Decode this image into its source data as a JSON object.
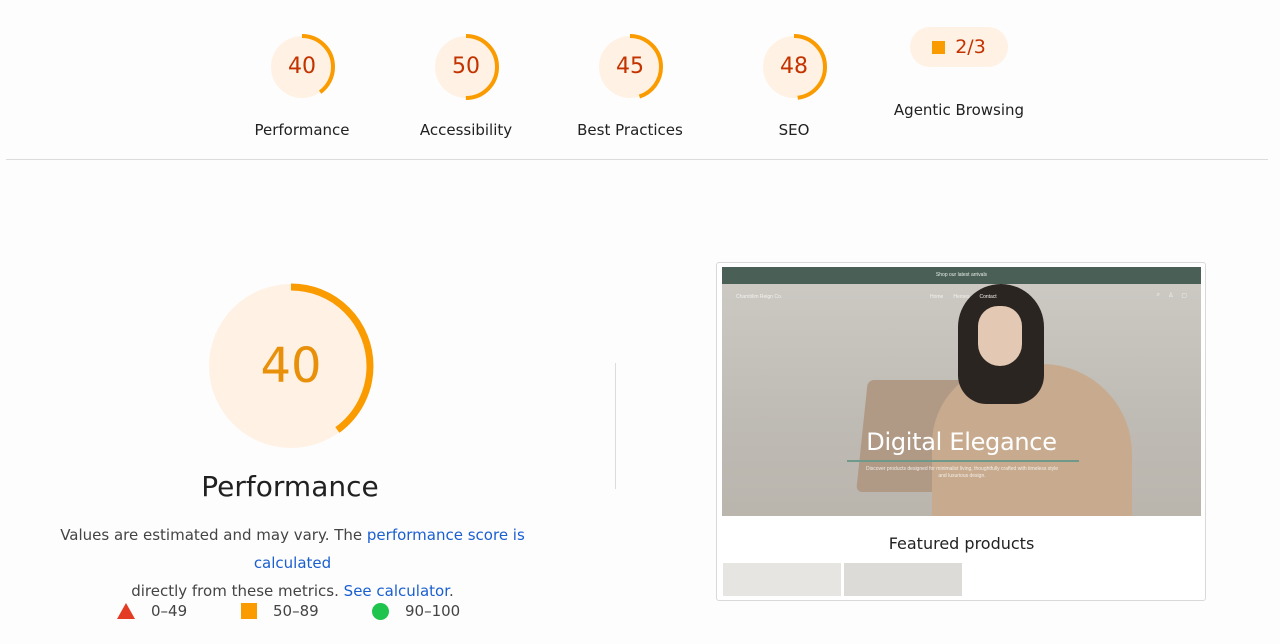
{
  "categories": [
    {
      "id": "performance",
      "score": 40,
      "label": "Performance"
    },
    {
      "id": "accessibility",
      "score": 50,
      "label": "Accessibility"
    },
    {
      "id": "best-practices",
      "score": 45,
      "label": "Best Practices"
    },
    {
      "id": "seo",
      "score": 48,
      "label": "SEO"
    }
  ],
  "agentic": {
    "fraction": "2/3",
    "label": "Agentic Browsing"
  },
  "main_gauge": {
    "score": 40,
    "title": "Performance"
  },
  "description": {
    "part1": "Values are estimated and may vary. The ",
    "link1": "performance score is calculated",
    "part2": " directly from these metrics. ",
    "link2": "See calculator",
    "part3": "."
  },
  "legend": [
    {
      "shape": "triangle",
      "color": "#e43b24",
      "range": "0–49"
    },
    {
      "shape": "square",
      "color": "#fa9b00",
      "range": "50–89"
    },
    {
      "shape": "circle",
      "color": "#1ec44c",
      "range": "90–100"
    }
  ],
  "colors": {
    "fail": "#e43b24",
    "average": "#fa9b00",
    "pass": "#1ec44c",
    "average_bg": "#fff1e3",
    "link": "#1a5fd0"
  },
  "preview": {
    "announcement": "Shop our latest arrivals",
    "brand": "Chamblim Reign Co.",
    "nav": [
      "Home",
      "Heroes",
      "Contact"
    ],
    "icons": [
      "search-icon",
      "account-icon",
      "cart-icon"
    ],
    "headline": "Digital Elegance",
    "subtext": "Discover products designed for minimalist living, thoughtfully crafted with timeless style and luxurious design.",
    "featured_title": "Featured products"
  }
}
